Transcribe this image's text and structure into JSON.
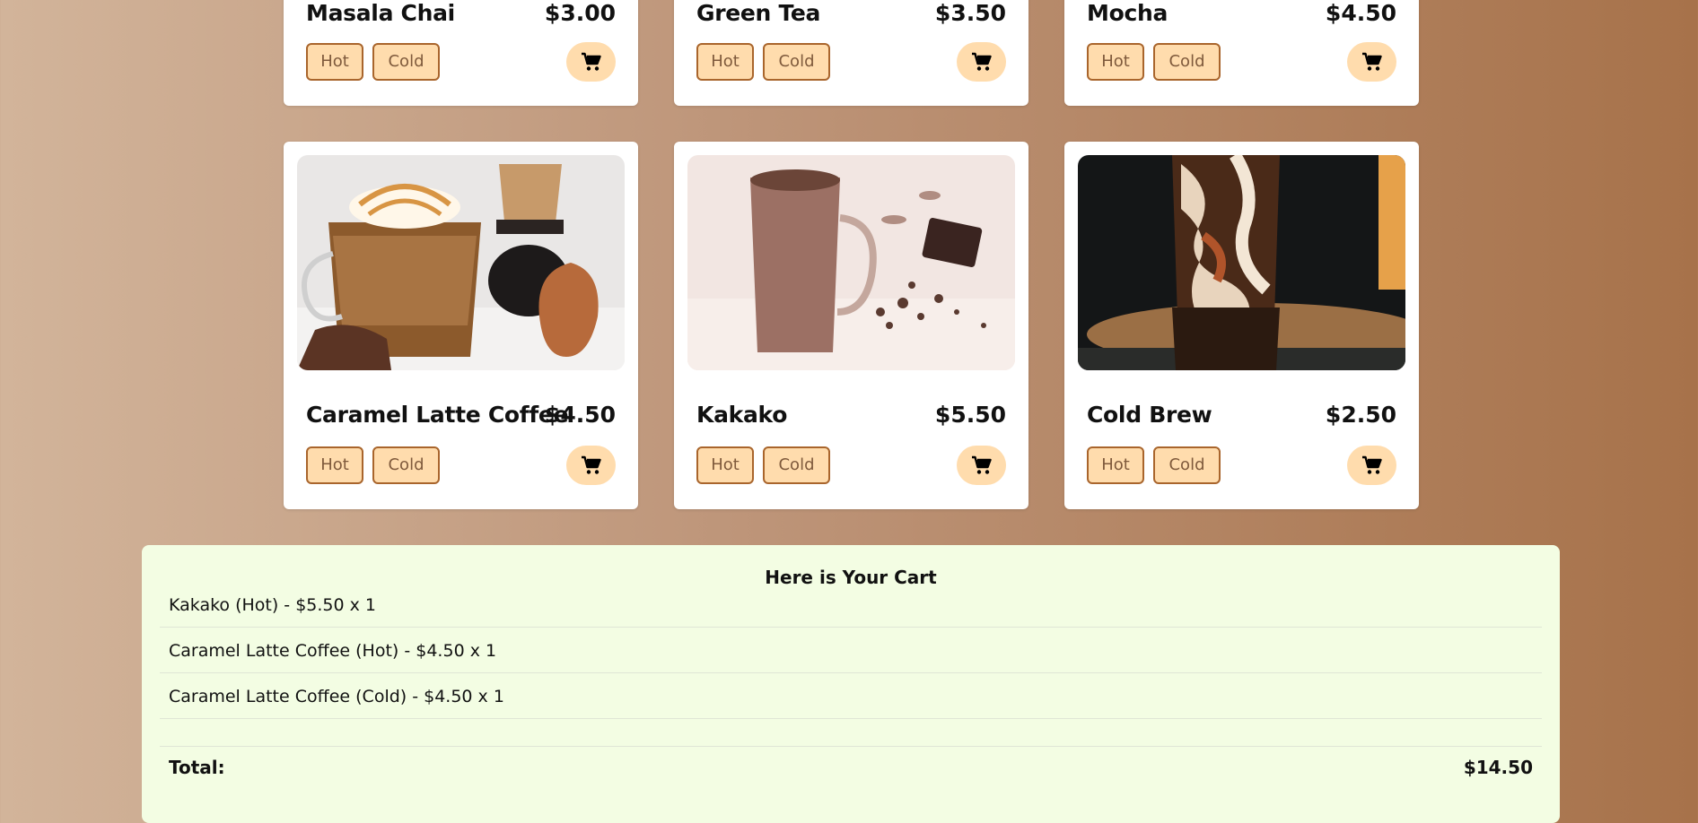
{
  "colors": {
    "background_start": "#d2b49a",
    "background_end": "#a7724a",
    "option_fill": "#ffdcad",
    "option_border": "#a9652c",
    "cart_panel": "#f3fde3"
  },
  "menu": {
    "top_row": [
      {
        "name": "Masala Chai",
        "price": "$3.00",
        "hot_label": "Hot",
        "cold_label": "Cold",
        "cart_icon": "cart-icon"
      },
      {
        "name": "Green Tea",
        "price": "$3.50",
        "hot_label": "Hot",
        "cold_label": "Cold",
        "cart_icon": "cart-icon"
      },
      {
        "name": "Mocha",
        "price": "$4.50",
        "hot_label": "Hot",
        "cold_label": "Cold",
        "cart_icon": "cart-icon"
      }
    ],
    "bottom_row": [
      {
        "name": "Caramel Latte Coffee",
        "price": "$4.50",
        "hot_label": "Hot",
        "cold_label": "Cold",
        "cart_icon": "cart-icon"
      },
      {
        "name": "Kakako",
        "price": "$5.50",
        "hot_label": "Hot",
        "cold_label": "Cold",
        "cart_icon": "cart-icon"
      },
      {
        "name": "Cold Brew",
        "price": "$2.50",
        "hot_label": "Hot",
        "cold_label": "Cold",
        "cart_icon": "cart-icon"
      }
    ]
  },
  "cart": {
    "title": "Here is Your Cart",
    "items": [
      "Kakako (Hot) - $5.50 x 1",
      "Caramel Latte Coffee (Hot) - $4.50 x 1",
      "Caramel Latte Coffee (Cold) - $4.50 x 1"
    ],
    "total_label": "Total:",
    "total_value": "$14.50"
  }
}
